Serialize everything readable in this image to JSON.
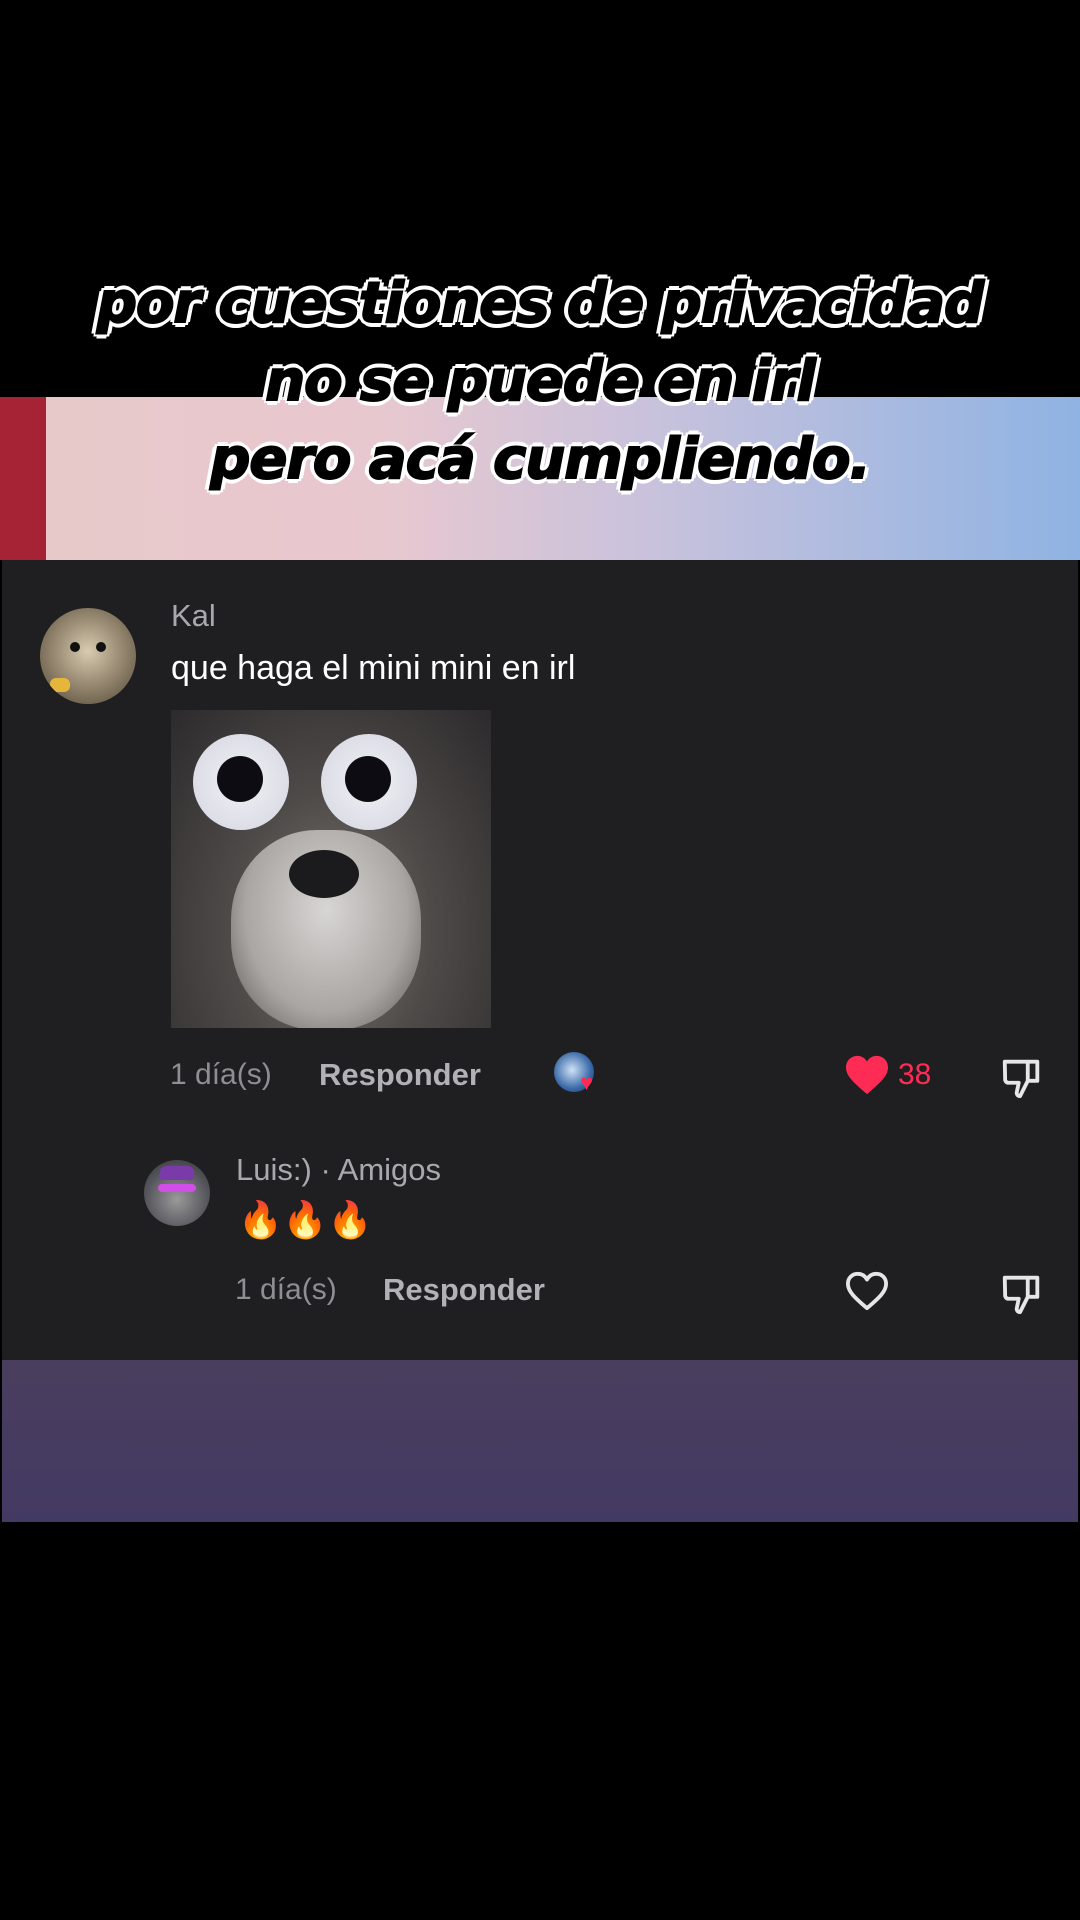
{
  "overlay": {
    "caption_lines": [
      "por cuestiones de privacidad",
      "no se puede en irl",
      "pero acá cumpliendo."
    ]
  },
  "comment": {
    "username": "Kal",
    "text": "que haga el mini mini en irl",
    "time": "1 día(s)",
    "reply_label": "Responder",
    "like_count": "38",
    "liked": true
  },
  "reply": {
    "username": "Luis:)",
    "tag": "· Amigos",
    "text": "🔥🔥🔥",
    "time": "1 día(s)",
    "reply_label": "Responder",
    "liked": false
  },
  "icons": {
    "like_active": "heart-filled-icon",
    "like_inactive": "heart-outline-icon",
    "dislike": "thumbs-down-icon"
  },
  "colors": {
    "panel_bg": "#1f1f21",
    "accent_like": "#fe2c55",
    "username": "#a9a9ad"
  }
}
